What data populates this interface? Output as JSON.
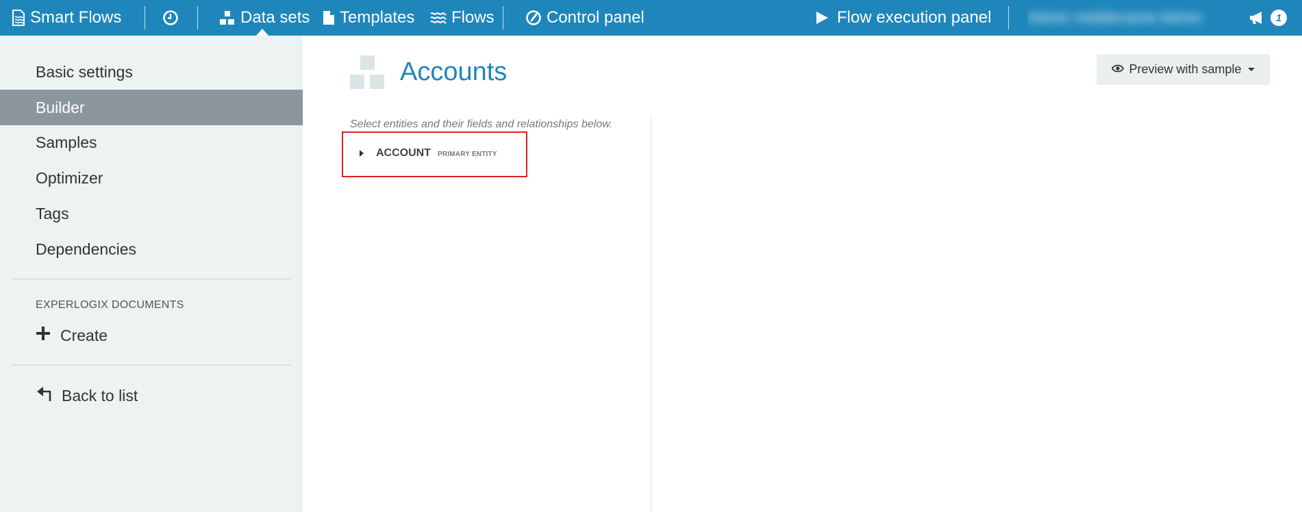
{
  "navbar": {
    "brand_label": "Smart Flows",
    "brand_icon": "document-waves-icon",
    "history_icon": "clock-icon",
    "items": [
      {
        "label": "Data sets",
        "icon": "sitemap-icon",
        "active": true
      },
      {
        "label": "Templates",
        "icon": "file-icon"
      },
      {
        "label": "Flows",
        "icon": "waves-icon"
      },
      {
        "label": "Control panel",
        "icon": "gauge-icon"
      }
    ],
    "flow_execution_label": "Flow execution panel",
    "flow_execution_icon": "play-icon",
    "user_name": "Admin middlename Admin",
    "announcement_icon": "megaphone-icon",
    "notification_count": "1"
  },
  "sidebar": {
    "items": [
      {
        "label": "Basic settings"
      },
      {
        "label": "Builder",
        "active": true
      },
      {
        "label": "Samples"
      },
      {
        "label": "Optimizer"
      },
      {
        "label": "Tags"
      },
      {
        "label": "Dependencies"
      }
    ],
    "section_heading": "EXPERLOGIX DOCUMENTS",
    "create_label": "Create",
    "create_icon": "plus-icon",
    "back_label": "Back to list",
    "back_icon": "back-arrow-icon"
  },
  "main": {
    "title": "Accounts",
    "title_icon": "blocks-icon",
    "preview_label": "Preview with sample",
    "preview_icon": "eye-icon",
    "hint": "Select entities and their fields and relationships below.",
    "entity": {
      "name": "ACCOUNT",
      "tag": "PRIMARY ENTITY"
    }
  },
  "colors": {
    "navbar": "#1f86bb",
    "sidebar": "#edf2f2",
    "active_item": "#8c969f",
    "title": "#1f86bb",
    "highlight_box": "#e02020"
  }
}
